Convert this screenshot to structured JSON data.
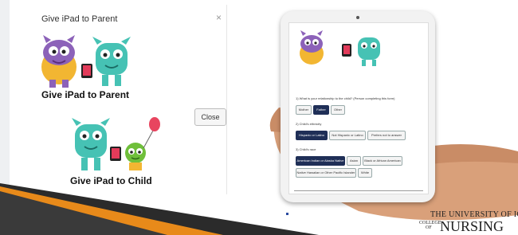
{
  "modal": {
    "title": "Give iPad to Parent",
    "close_x": "×",
    "parent_label": "Give iPad to Parent",
    "child_label": "Give iPad to Child",
    "close_button": "Close"
  },
  "ipad": {
    "q1": "1) What is your relationship to the child? (Person completing this form)",
    "q1_options": [
      "Mother",
      "Father",
      "Other"
    ],
    "q1_selected": "Father",
    "q2": "2) Child's ethnicity",
    "q2_options": [
      "Hispanic or Latino",
      "Not Hispanic or Latino",
      "Prefers not to answer"
    ],
    "q2_selected": "Hispanic or Latino",
    "q3": "3) Child's race",
    "q3_options": [
      "American Indian or Alaska Native",
      "Asian",
      "Black or African American",
      "Native Hawaiian or Other Pacific Islander",
      "White"
    ],
    "q3_selected": "American Indian or Alaska Native"
  },
  "logo": {
    "line1": "THE UNIVERSITY OF IOWA",
    "line2a": "COLLEGE",
    "line2b": "OF",
    "line3": "NURSING"
  },
  "colors": {
    "selected_option": "#1f2f57",
    "sweep_dark": "#2b2b2b",
    "sweep_orange": "#e88a1a"
  }
}
